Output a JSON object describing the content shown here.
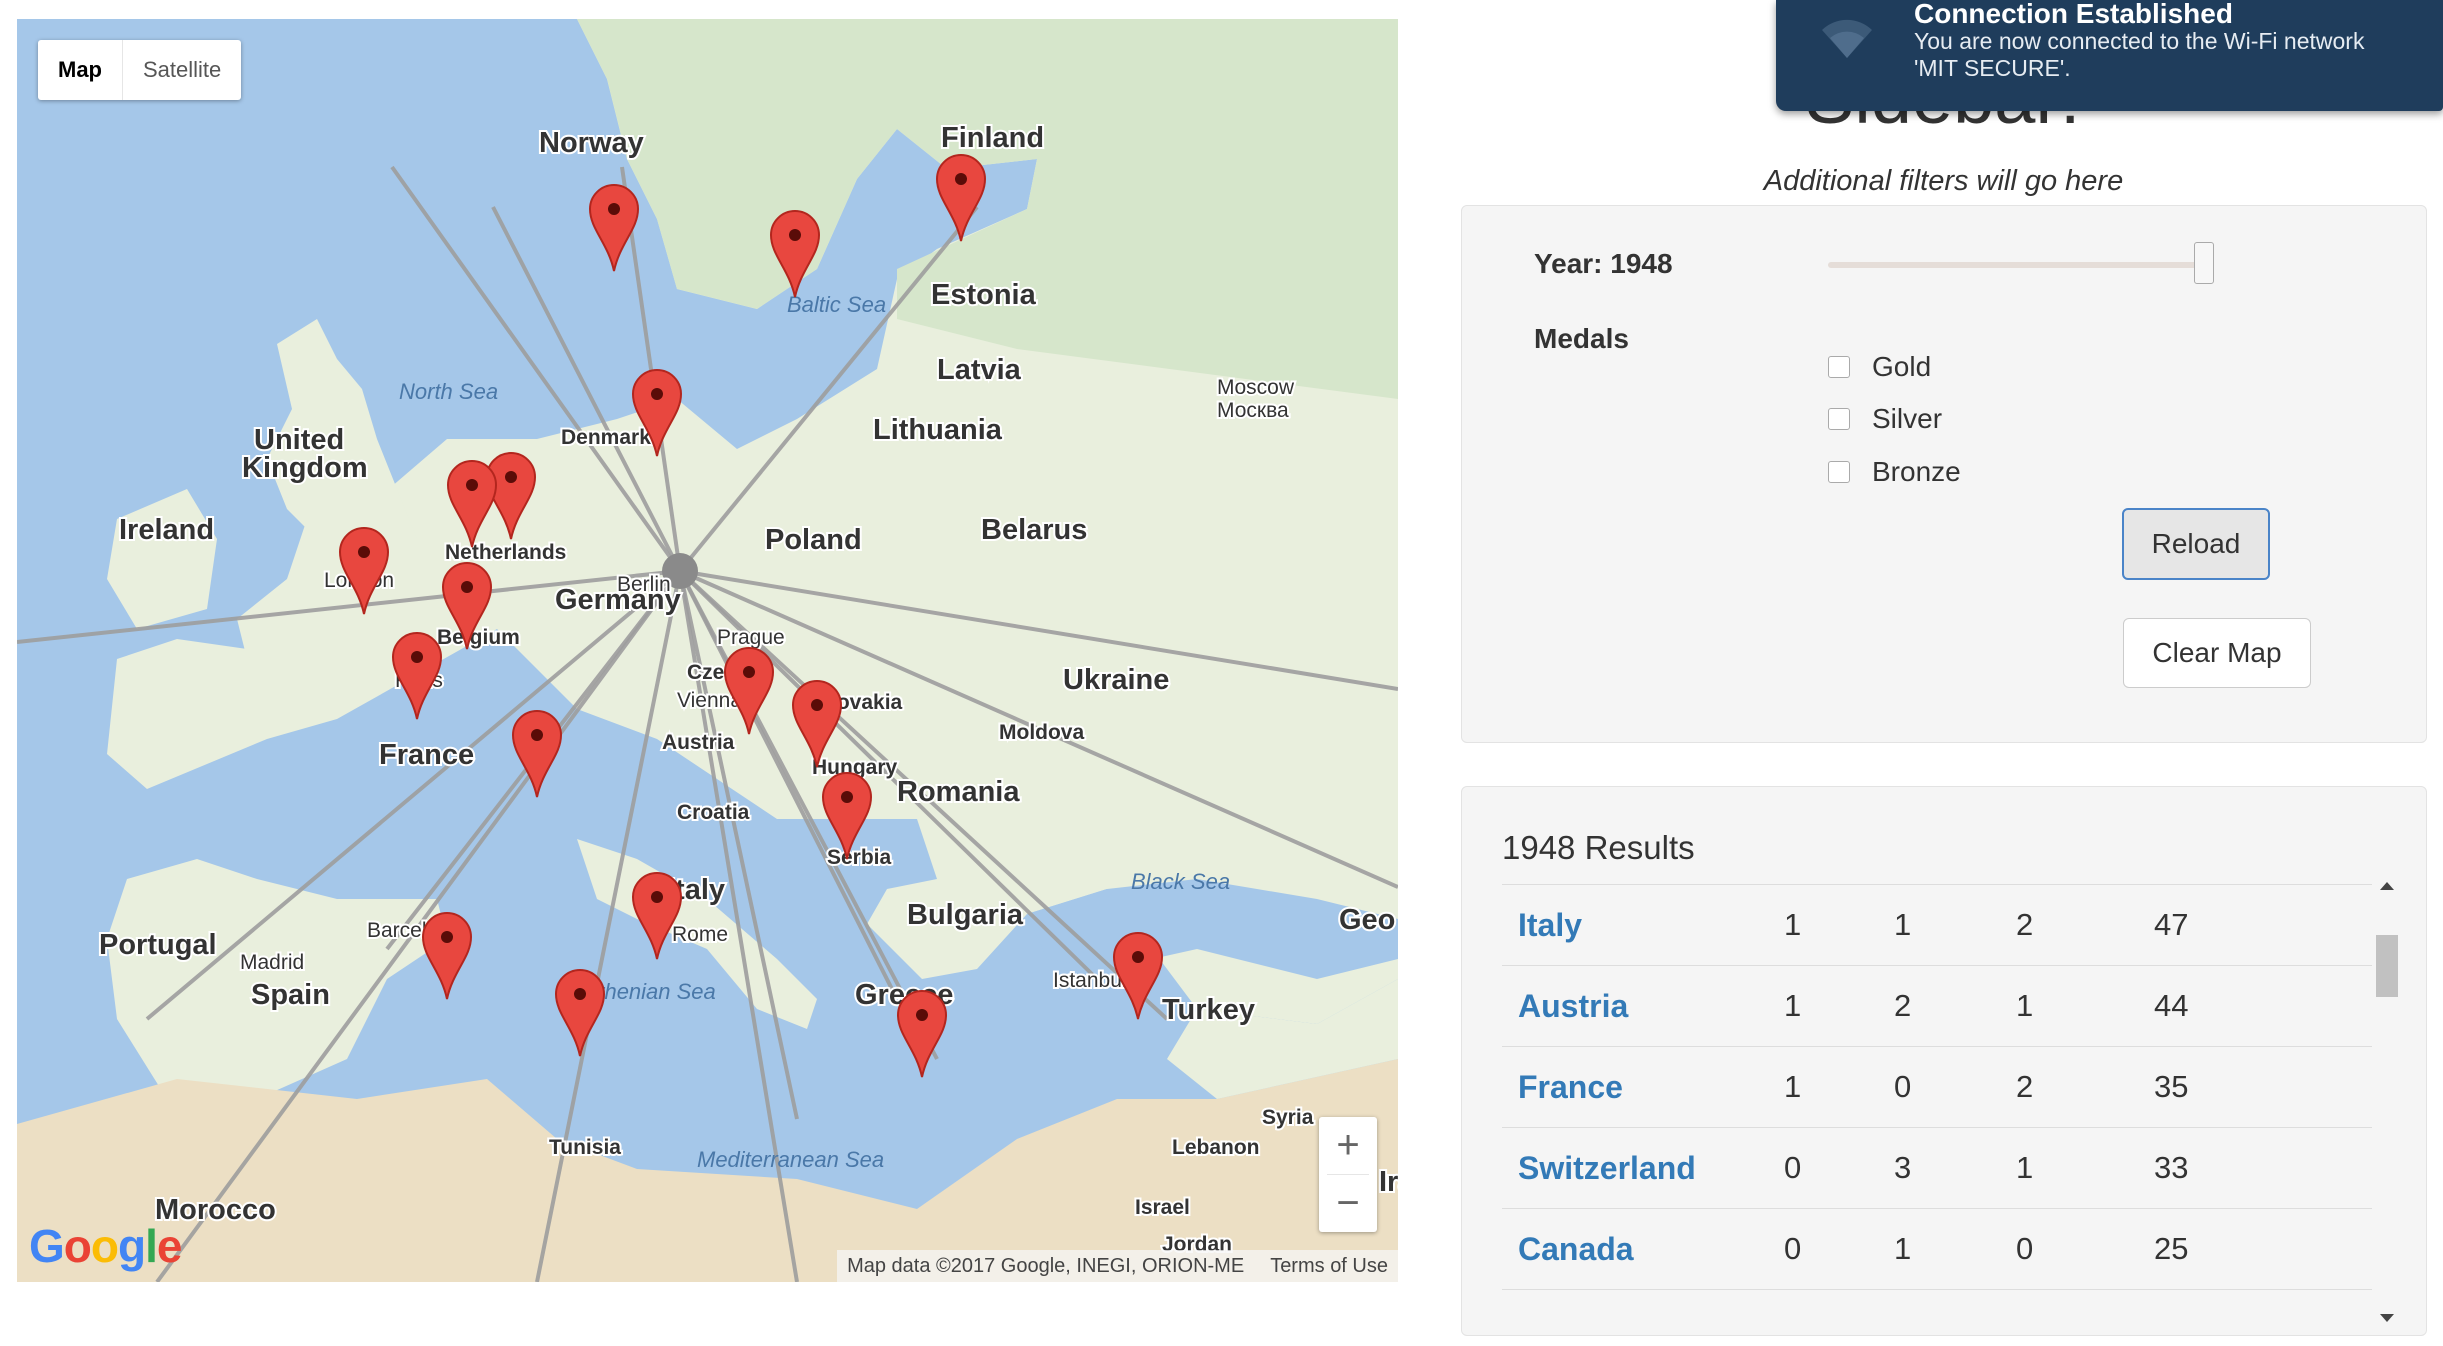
{
  "map": {
    "type_control": [
      "Map",
      "Satellite"
    ],
    "active_type": "Map",
    "zoom_in": "+",
    "zoom_out": "−",
    "logo": [
      "G",
      "o",
      "o",
      "g",
      "l",
      "e"
    ],
    "attribution": "Map data ©2017 Google, INEGI, ORION-ME",
    "terms": "Terms of Use",
    "colors": {
      "water": "#a5c7e9",
      "land": "#e9efdd",
      "land_north": "#d6e6cb",
      "desert": "#ecdfc4",
      "line": "#9e9e9e",
      "marker": "#e8473f"
    },
    "labels": {
      "countries": [
        "Norway",
        "Finland",
        "Estonia",
        "Latvia",
        "Lithuania",
        "Denmark",
        "United",
        "Kingdom",
        "Ireland",
        "Netherlands",
        "Poland",
        "Belarus",
        "Germany",
        "Belgium",
        "Ukraine",
        "France",
        "Austria",
        "Hungary",
        "Moldova",
        "Romania",
        "Croatia",
        "Serbia",
        "Bulgaria",
        "Portugal",
        "Spain",
        "Greece",
        "Turkey",
        "Tunisia",
        "Morocco",
        "Syria",
        "Lebanon",
        "Israel",
        "Jordan",
        "Italy",
        "Czech",
        "Slovakia",
        "Geo",
        "Ira"
      ],
      "cities": [
        "Moscow",
        "Москва",
        "London",
        "Paris",
        "Berlin",
        "Prague",
        "Vienna",
        "Rome",
        "Madrid",
        "Barcelona",
        "Istanbul"
      ],
      "water": [
        "North Sea",
        "Baltic Sea",
        "Black Sea",
        "Tyrrhenian Sea",
        "Mediterranean Sea"
      ]
    }
  },
  "notification": {
    "title": "Connection Established",
    "body": "You are now connected to the Wi-Fi network 'MIT SECURE'."
  },
  "sidebar": {
    "title": "Sidebar!",
    "subtitle": "Additional filters will go here",
    "year_label": "Year: 1948",
    "slider_position": 1.0,
    "medals_label": "Medals",
    "medals": [
      "Gold",
      "Silver",
      "Bronze"
    ],
    "reload_label": "Reload",
    "clear_label": "Clear Map"
  },
  "results": {
    "title": "1948 Results",
    "rows": [
      {
        "country": "Italy",
        "gold": "1",
        "silver": "1",
        "bronze": "2",
        "total": "47"
      },
      {
        "country": "Austria",
        "gold": "1",
        "silver": "2",
        "bronze": "1",
        "total": "44"
      },
      {
        "country": "France",
        "gold": "1",
        "silver": "0",
        "bronze": "2",
        "total": "35"
      },
      {
        "country": "Switzerland",
        "gold": "0",
        "silver": "3",
        "bronze": "1",
        "total": "33"
      },
      {
        "country": "Canada",
        "gold": "0",
        "silver": "1",
        "bronze": "0",
        "total": "25"
      }
    ]
  }
}
